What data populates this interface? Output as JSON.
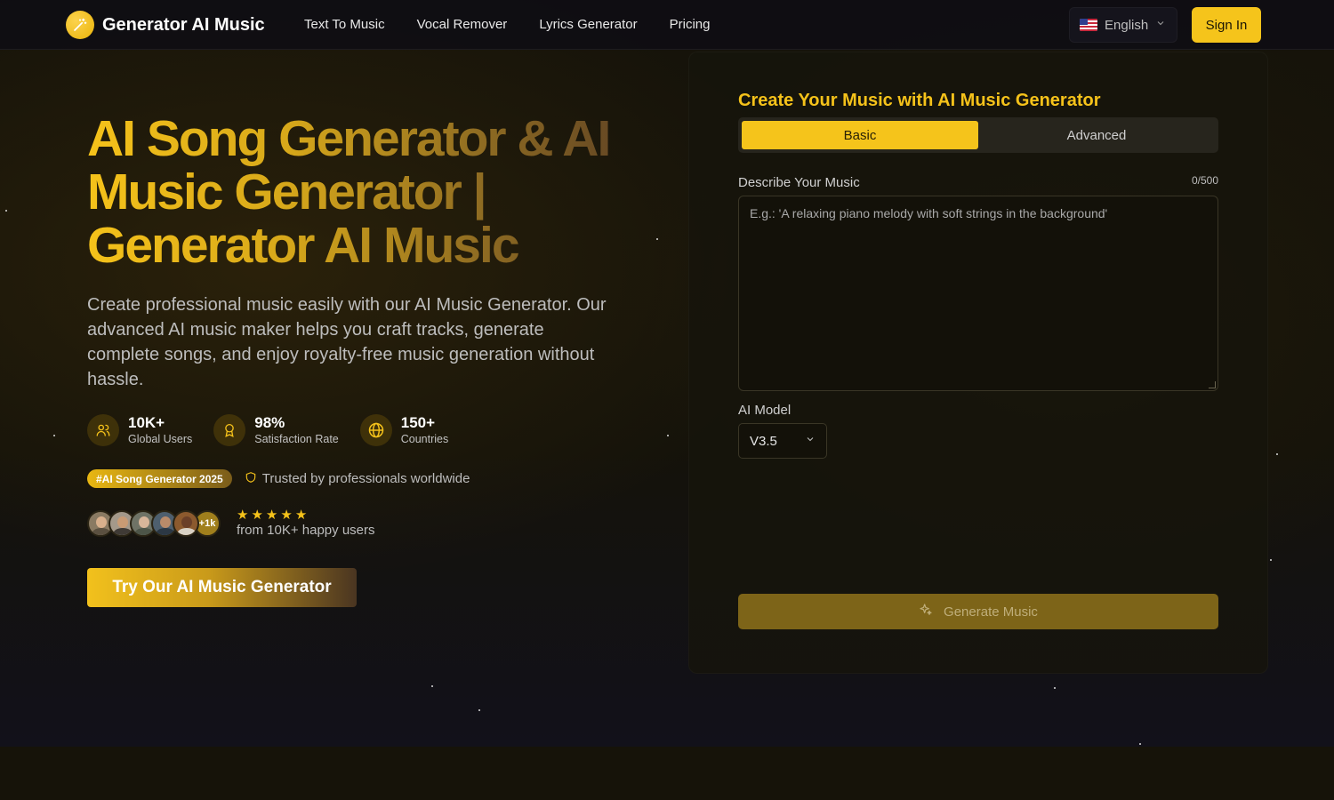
{
  "nav": {
    "brand": "Generator AI Music",
    "links": [
      "Text To Music",
      "Vocal Remover",
      "Lyrics Generator",
      "Pricing"
    ],
    "language": "English",
    "sign_in": "Sign In"
  },
  "hero": {
    "title": "AI Song Generator & AI Music Generator | Generator AI Music",
    "description": "Create professional music easily with our AI Music Generator. Our advanced AI music maker helps you craft tracks, generate complete songs, and enjoy royalty-free music generation without hassle.",
    "stats": [
      {
        "value": "10K+",
        "label": "Global Users",
        "icon": "users-icon"
      },
      {
        "value": "98%",
        "label": "Satisfaction Rate",
        "icon": "award-icon"
      },
      {
        "value": "150+",
        "label": "Countries",
        "icon": "globe-icon"
      }
    ],
    "tag": "#AI Song Generator 2025",
    "trusted": "Trusted by professionals worldwide",
    "avatars_more": "+1k",
    "rating_stars": 5,
    "rating_text": "from 10K+ happy users",
    "cta": "Try Our AI Music Generator"
  },
  "panel": {
    "title": "Create Your Music with AI Music Generator",
    "tabs": [
      {
        "label": "Basic",
        "active": true
      },
      {
        "label": "Advanced",
        "active": false
      }
    ],
    "describe_label": "Describe Your Music",
    "counter": "0/500",
    "placeholder": "E.g.: 'A relaxing piano melody with soft strings in the background'",
    "model_label": "AI Model",
    "model_value": "V3.5",
    "generate": "Generate Music"
  },
  "colors": {
    "accent": "#f5c41b",
    "background": "#14120a"
  }
}
